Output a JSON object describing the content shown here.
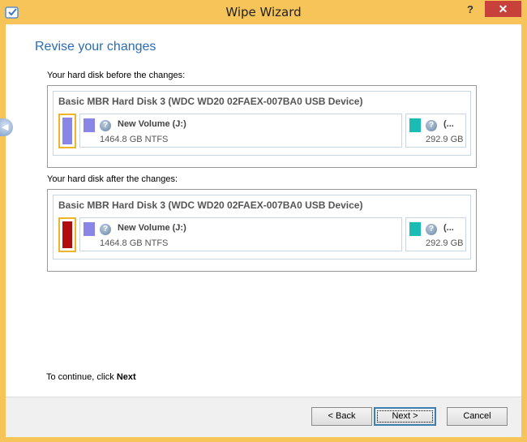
{
  "window": {
    "title": "Wipe Wizard",
    "help_label": "?",
    "close_label": "✕",
    "icons": {
      "app": "app-icon",
      "help": "help-icon",
      "close": "close-icon"
    }
  },
  "main": {
    "heading": "Revise your changes",
    "before_label": "Your hard disk before the changes:",
    "after_label": "Your hard disk after the changes:",
    "continue_prefix": "To continue, click ",
    "continue_emphasis": "Next"
  },
  "before": {
    "disk_name": "Basic MBR Hard Disk 3 (WDC WD20 02FAEX-007BA0 USB Device)",
    "disk_icon_color": "#8a86e8",
    "partitions": [
      {
        "name": "New Volume (J:)",
        "size": "1464.8 GB NTFS",
        "color": "#8a86e8"
      },
      {
        "name": "(...",
        "size": "292.9 GB",
        "color": "#1abcb4"
      }
    ]
  },
  "after": {
    "disk_name": "Basic MBR Hard Disk 3 (WDC WD20 02FAEX-007BA0 USB Device)",
    "disk_icon_color": "#b00e0e",
    "partitions": [
      {
        "name": "New Volume (J:)",
        "size": "1464.8 GB NTFS",
        "color": "#8a86e8"
      },
      {
        "name": "(...",
        "size": "292.9 GB",
        "color": "#1abcb4"
      }
    ]
  },
  "footer": {
    "back_label": "< Back",
    "next_label": "Next >",
    "cancel_label": "Cancel"
  }
}
